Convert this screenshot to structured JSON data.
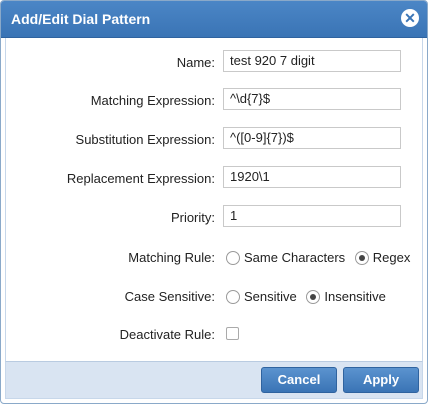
{
  "dialog": {
    "title": "Add/Edit Dial Pattern",
    "close_icon": "close-icon"
  },
  "fields": {
    "name_label": "Name:",
    "name_value": "test 920 7 digit",
    "matching_label": "Matching Expression:",
    "matching_value": "^\\d{7}$",
    "substitution_label": "Substitution Expression:",
    "substitution_value": "^([0-9]{7})$",
    "replacement_label": "Replacement Expression:",
    "replacement_value": "1920\\1",
    "priority_label": "Priority:",
    "priority_value": "1",
    "matching_rule_label": "Matching Rule:",
    "matching_rule_options": [
      "Same Characters",
      "Regex"
    ],
    "matching_rule_selected": "Regex",
    "case_label": "Case Sensitive:",
    "case_options": [
      "Sensitive",
      "Insensitive"
    ],
    "case_selected": "Insensitive",
    "deactivate_label": "Deactivate Rule:",
    "deactivate_checked": false
  },
  "footer": {
    "cancel_label": "Cancel",
    "apply_label": "Apply"
  }
}
